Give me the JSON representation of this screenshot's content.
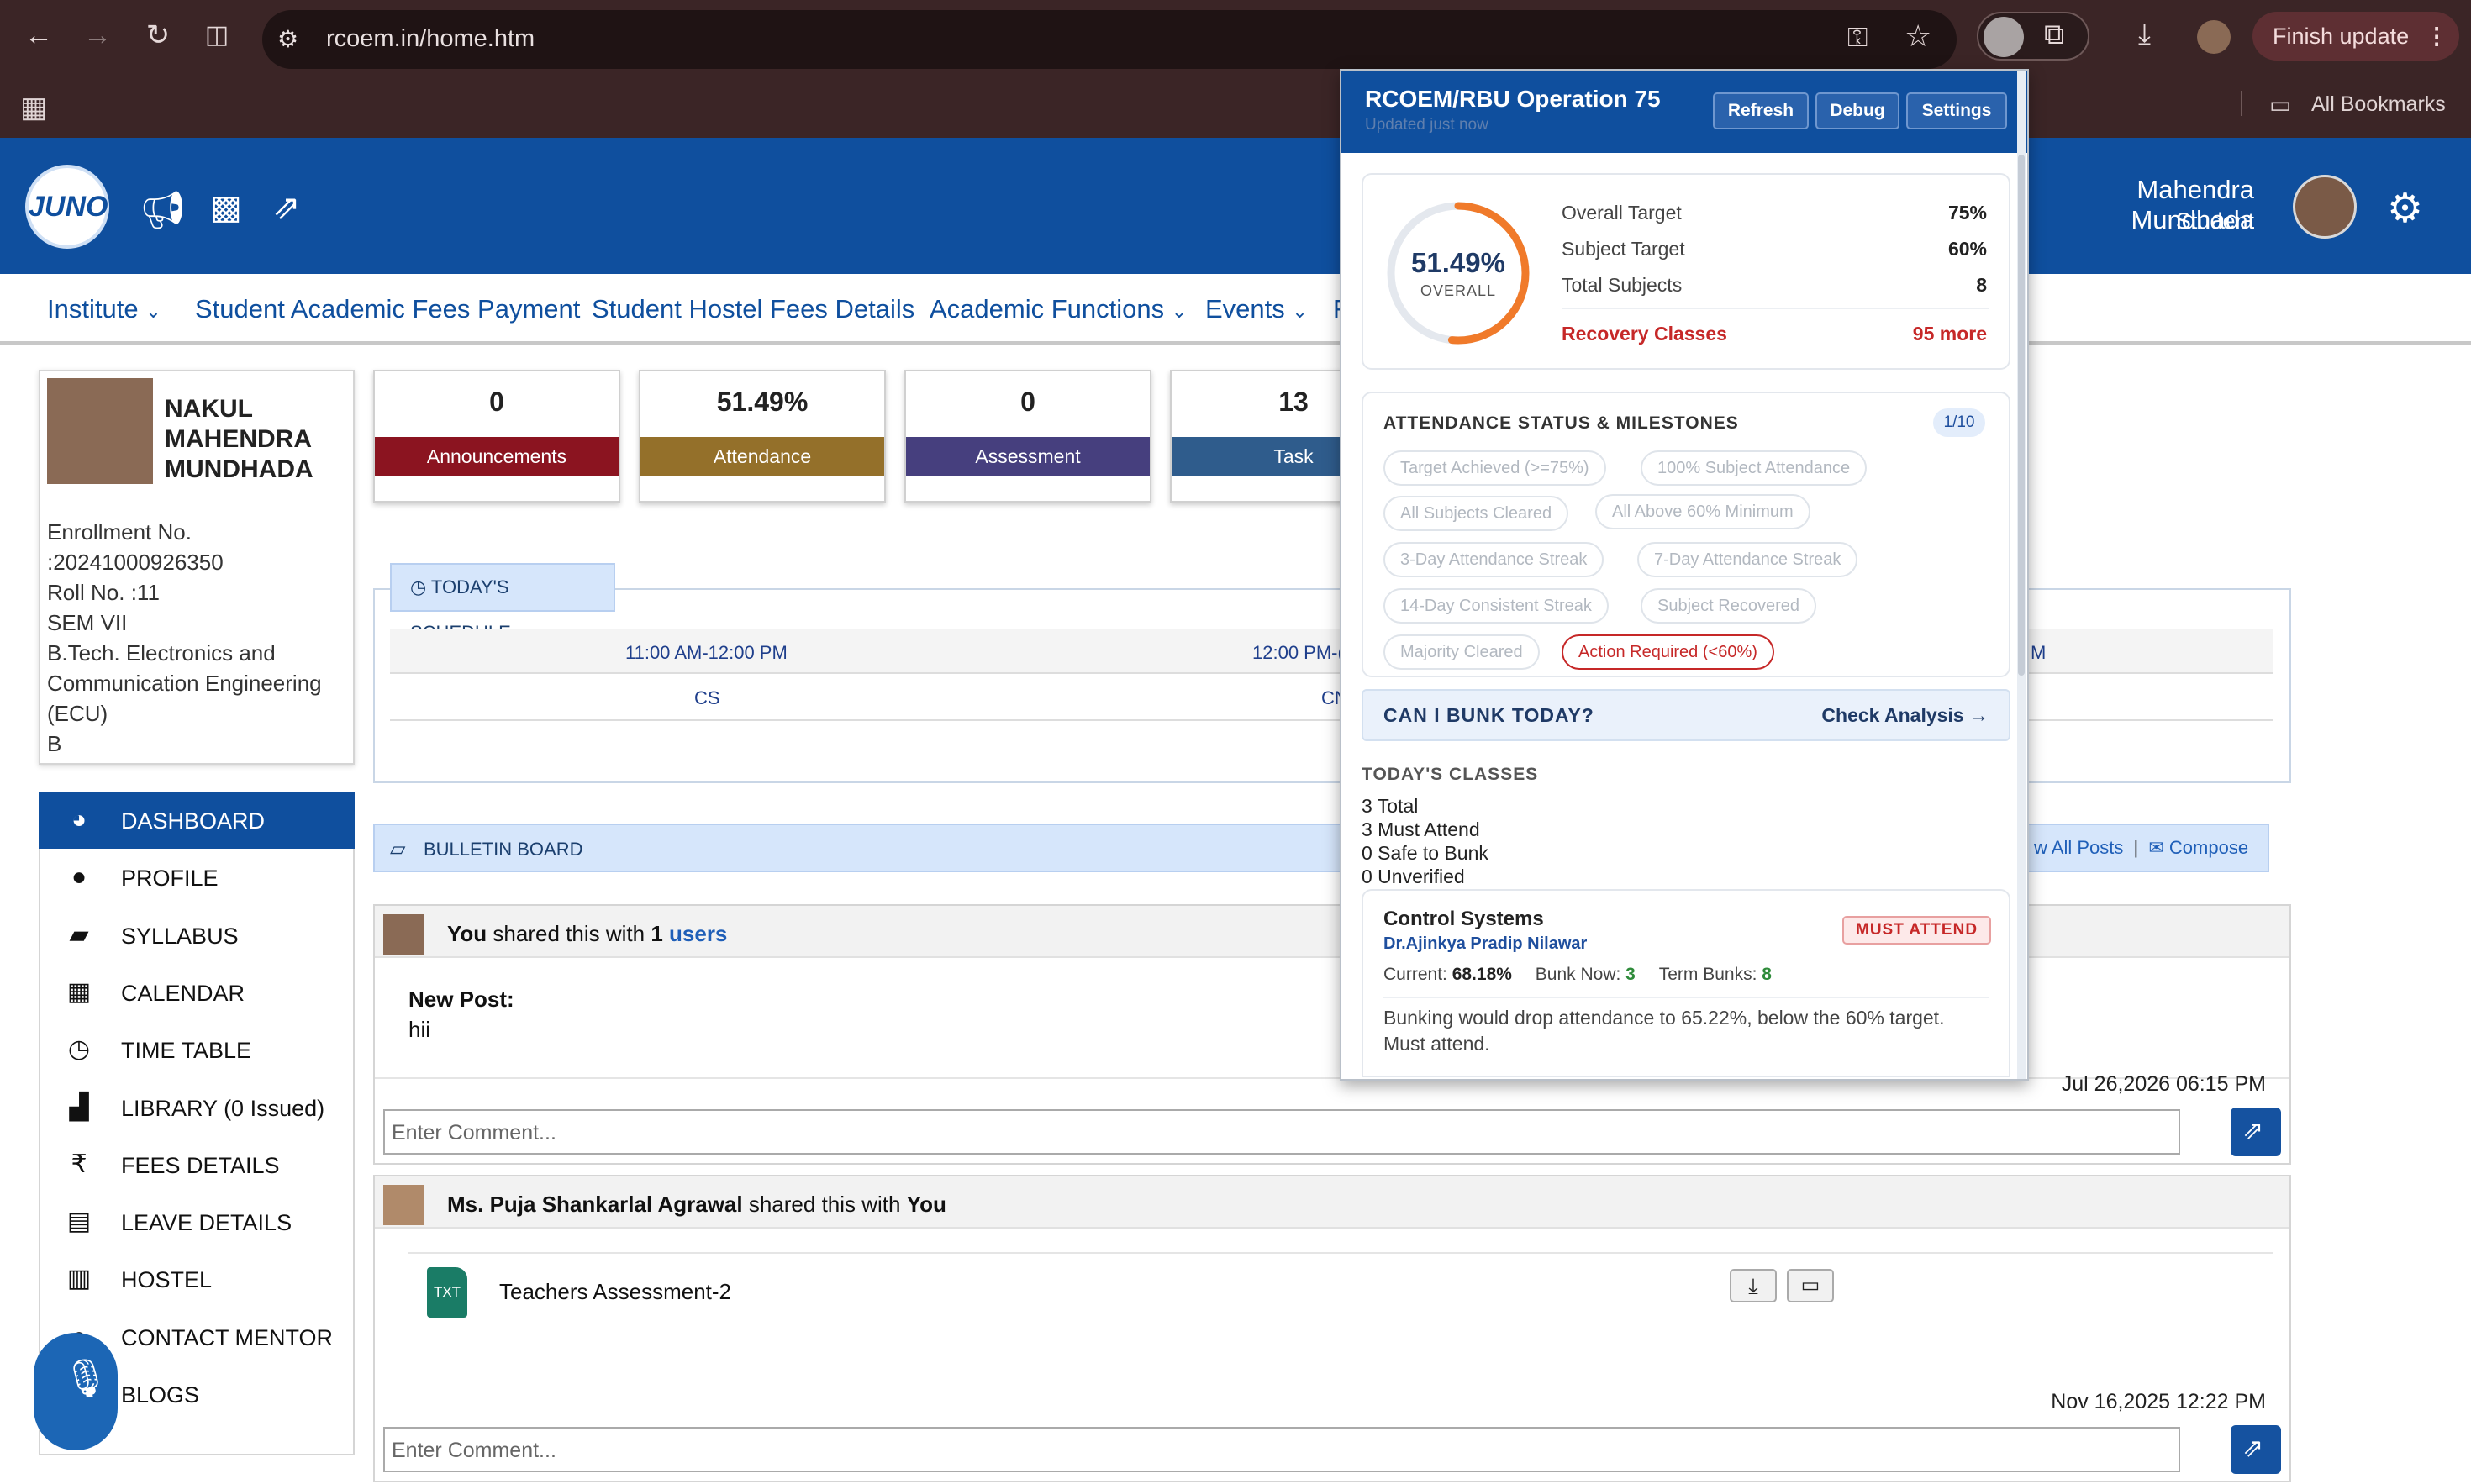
{
  "browser": {
    "url": "rcoem.in/home.htm",
    "finish_update": "Finish update",
    "all_bookmarks": "All Bookmarks"
  },
  "header": {
    "logo_text": "JUNO",
    "user_name": "Mahendra Mundhada",
    "user_role": "Student"
  },
  "nav": {
    "items": [
      "Institute",
      "Student Academic Fees Payment",
      "Student Hostel Fees Details",
      "Academic Functions",
      "Events",
      "F"
    ]
  },
  "profile": {
    "name_lines": [
      "NAKUL",
      "MAHENDRA",
      "MUNDHADA"
    ],
    "lines": [
      "Enrollment No.",
      ":20241000926350",
      "Roll No. :11",
      "SEM VII",
      "B.Tech. Electronics and",
      "Communication Engineering",
      "(ECU)",
      "B"
    ]
  },
  "sidebar": {
    "items": [
      {
        "label": "DASHBOARD",
        "icon": "dashboard-icon",
        "glyph": "◕",
        "active": true
      },
      {
        "label": "PROFILE",
        "icon": "user-icon",
        "glyph": "●",
        "active": false
      },
      {
        "label": "SYLLABUS",
        "icon": "book-icon",
        "glyph": "▰",
        "active": false
      },
      {
        "label": "CALENDAR",
        "icon": "calendar-icon",
        "glyph": "▦",
        "active": false
      },
      {
        "label": "TIME TABLE",
        "icon": "clock-icon",
        "glyph": "◷",
        "active": false
      },
      {
        "label": "LIBRARY (0 Issued)",
        "icon": "bar-chart-icon",
        "glyph": "▟",
        "active": false
      },
      {
        "label": "FEES DETAILS",
        "icon": "rupee-icon",
        "glyph": "₹",
        "active": false
      },
      {
        "label": "LEAVE DETAILS",
        "icon": "document-icon",
        "glyph": "▤",
        "active": false
      },
      {
        "label": "HOSTEL",
        "icon": "building-icon",
        "glyph": "▥",
        "active": false
      },
      {
        "label": "CONTACT MENTOR",
        "icon": "contact-icon",
        "glyph": "●",
        "active": false
      },
      {
        "label": "BLOGS",
        "icon": "blog-icon",
        "glyph": "▭",
        "active": false
      }
    ]
  },
  "stats": [
    {
      "value": "0",
      "label": "Announcements",
      "color": "#8b1420"
    },
    {
      "value": "51.49%",
      "label": "Attendance",
      "color": "#94702a"
    },
    {
      "value": "0",
      "label": "Assessment",
      "color": "#463f7e"
    },
    {
      "value": "13",
      "label": "Task",
      "color": "#2f5c8c"
    }
  ],
  "schedule": {
    "tab_label": "TODAY'S SCHEDULE",
    "times": [
      "11:00 AM-12:00 PM",
      "12:00 PM-(",
      "M"
    ],
    "subjects": [
      "CS",
      "CN"
    ]
  },
  "bulletin": {
    "label": "BULLETIN BOARD",
    "view_all": "w All Posts",
    "separator": "|",
    "compose": "Compose"
  },
  "posts": [
    {
      "author": "You",
      "shared_text": "shared this with",
      "count": "1",
      "target": "users",
      "title": "New Post:",
      "body": "hii",
      "date": "Jul 26,2026 06:15 PM",
      "comment_placeholder": "Enter Comment..."
    },
    {
      "author": "Ms. Puja Shankarlal Agrawal",
      "shared_text": "shared this with",
      "target": "You",
      "file_type": "TXT",
      "file_name": "Teachers Assessment-2",
      "date": "Nov 16,2025 12:22 PM",
      "comment_placeholder": "Enter Comment..."
    }
  ],
  "popup": {
    "title": "RCOEM/RBU Operation 75",
    "updated": "Updated just now",
    "buttons": [
      "Refresh",
      "Debug",
      "Settings"
    ],
    "overall_percent": "51.49%",
    "overall_label": "OVERALL",
    "overall_fraction": 0.5149,
    "targets": [
      {
        "label": "Overall Target",
        "value": "75%"
      },
      {
        "label": "Subject Target",
        "value": "60%"
      },
      {
        "label": "Total Subjects",
        "value": "8"
      }
    ],
    "recovery_label": "Recovery Classes",
    "recovery_value": "95 more",
    "milestones_title": "ATTENDANCE STATUS & MILESTONES",
    "milestones_count": "1/10",
    "chips": [
      "Target Achieved (>=75%)",
      "100% Subject Attendance",
      "All Subjects Cleared",
      "All Above 60% Minimum",
      "3-Day Attendance Streak",
      "7-Day Attendance Streak",
      "14-Day Consistent Streak",
      "Subject Recovered",
      "Majority Cleared",
      "Action Required (<60%)"
    ],
    "bunk_question": "CAN I BUNK TODAY?",
    "check_analysis": "Check Analysis →",
    "todays_classes_title": "TODAY'S CLASSES",
    "class_stats": [
      "3 Total",
      "3 Must Attend",
      "0 Safe to Bunk",
      "0 Unverified"
    ],
    "class": {
      "name": "Control Systems",
      "badge": "MUST ATTEND",
      "teacher": "Dr.Ajinkya Pradip Nilawar",
      "current_label": "Current:",
      "current_value": "68.18%",
      "bunk_now_label": "Bunk Now:",
      "bunk_now_value": "3",
      "term_bunks_label": "Term Bunks:",
      "term_bunks_value": "8",
      "note": "Bunking would drop attendance to 65.22%, below the 60% target. Must attend."
    }
  },
  "colors": {
    "brand": "#0f4f9e",
    "danger": "#c62828",
    "ring": "#f07a2a",
    "success": "#2e8b3a"
  }
}
